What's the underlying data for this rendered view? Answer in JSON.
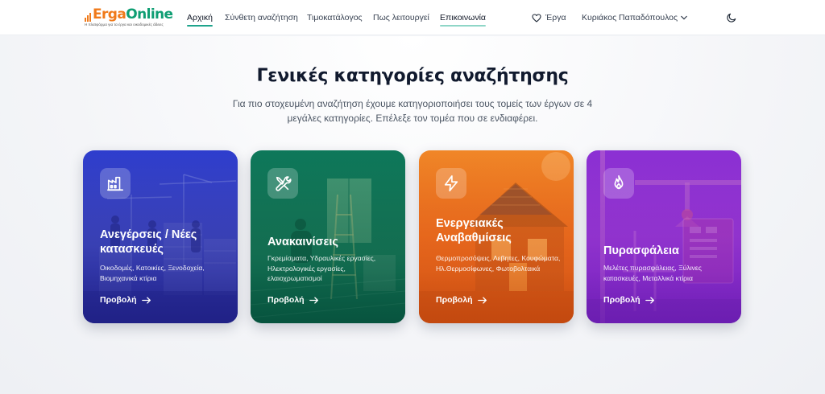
{
  "brand": {
    "name_part1": "Erga",
    "name_part2": "Online",
    "tagline": "Η πλατφόρμα για τα έργα και οικοδομικές άδειες"
  },
  "nav": {
    "items": [
      {
        "label": "Αρχική",
        "active": true
      },
      {
        "label": "Σύνθετη αναζήτηση",
        "active": false
      },
      {
        "label": "Τιμοκατάλογος",
        "active": false
      },
      {
        "label": "Πως λειτουργεί",
        "active": false
      },
      {
        "label": "Επικοινωνία",
        "active": true
      }
    ]
  },
  "header": {
    "works_label": "Έργα",
    "user_name": "Κυριάκος Παπαδόπουλος",
    "icons": {
      "works": "heart-icon",
      "user_menu": "chevron-down-icon",
      "theme": "moon-icon"
    }
  },
  "hero": {
    "title": "Γενικές κατηγορίες αναζήτησης",
    "subtitle": "Για πιο στοχευμένη αναζήτηση έχουμε κατηγοριοποιήσει τους τομείς των έργων σε 4 μεγάλες κατηγορίες. Επέλεξε τον τομέα που σε ενδιαφέρει."
  },
  "categories": [
    {
      "title": "Ανεγέρσεις / Νέες κατασκευές",
      "description": "Οικοδομές, Κατοικίες, Ξενοδοχεία, Βιομηχανικά κτίρια",
      "link": "Προβολή",
      "icon": "factory-icon",
      "color": "#3b3fc4"
    },
    {
      "title": "Ανακαινίσεις",
      "description": "Γκρεμίσματα, Υδραυλικές εργασίες, Ηλεκτρολογικές εργασίες, ελαιοχρωματισμοί",
      "link": "Προβολή",
      "icon": "tools-icon",
      "color": "#0f7a5c"
    },
    {
      "title": "Ενεργειακές Αναβαθμίσεις",
      "description": "Θερμοπροσόψεις, Λεβητες, Κουφώματα, Ηλ.Θερμοσίφωνες, Φωτοβολταικά",
      "link": "Προβολή",
      "icon": "lightning-icon",
      "color": "#e8621c"
    },
    {
      "title": "Πυρασφάλεια",
      "description": "Μελέτες πυρασφάλειας, Ξύλινες κατασκευές, Μεταλλικά κτίρια",
      "link": "Προβολή",
      "icon": "flame-icon",
      "color": "#8a2fd0"
    }
  ]
}
